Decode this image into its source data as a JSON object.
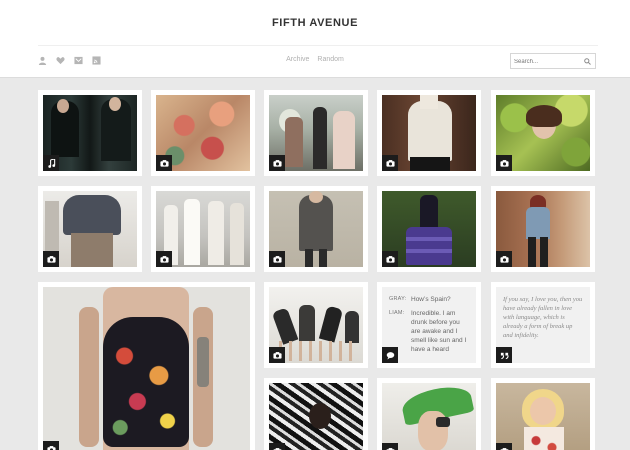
{
  "header": {
    "title": "FIFTH AVENUE",
    "nav": {
      "archive": "Archive",
      "random": "Random"
    },
    "search_placeholder": "Search...",
    "icons": [
      "user-icon",
      "heart-icon",
      "mail-icon",
      "rss-icon"
    ]
  },
  "posts": [
    {
      "type": "audio",
      "badge": "music-note-icon",
      "description": "two men in dark coats"
    },
    {
      "type": "photo",
      "badge": "camera-icon",
      "description": "face covered in painted flowers"
    },
    {
      "type": "photo",
      "badge": "camera-icon",
      "description": "women with bouquet on street"
    },
    {
      "type": "photo",
      "badge": "camera-icon",
      "description": "white blouse outfit"
    },
    {
      "type": "photo",
      "badge": "camera-icon",
      "description": "woman among leaves"
    },
    {
      "type": "photo",
      "badge": "camera-icon",
      "description": "draped top look"
    },
    {
      "type": "photo",
      "badge": "camera-icon",
      "description": "runway models in white"
    },
    {
      "type": "photo",
      "badge": "camera-icon",
      "description": "grey coat street style"
    },
    {
      "type": "photo",
      "badge": "camera-icon",
      "description": "purple skirt look"
    },
    {
      "type": "photo",
      "badge": "camera-icon",
      "description": "denim shirt by brick wall"
    },
    {
      "type": "photo",
      "badge": "camera-icon",
      "description": "tattooed model in floral swimsuit"
    },
    {
      "type": "photo",
      "badge": "camera-icon",
      "description": "girls bending over"
    },
    {
      "type": "photo",
      "badge": "camera-icon",
      "description": "black and white zebra pattern"
    },
    {
      "type": "photo",
      "badge": "camera-icon",
      "description": "green visor hat"
    },
    {
      "type": "photo",
      "badge": "camera-icon",
      "description": "blonde model in print dress"
    }
  ],
  "chat": {
    "badge": "speech-bubble-icon",
    "lines": [
      {
        "who": "GRAY:",
        "text": "How’s Spain?"
      },
      {
        "who": "LIAM:",
        "text": "Incredible. I am drunk before you are awake and I smell like sun and I have a heard"
      }
    ]
  },
  "quote": {
    "badge": "quote-icon",
    "text": "If you say, I love you, then you have already fallen in love with language, which is already a form of break up and infidelity."
  },
  "colors": {
    "background": "#e9e9e9",
    "card": "#ffffff",
    "badge": "#1c1c1c",
    "title": "#333333"
  }
}
